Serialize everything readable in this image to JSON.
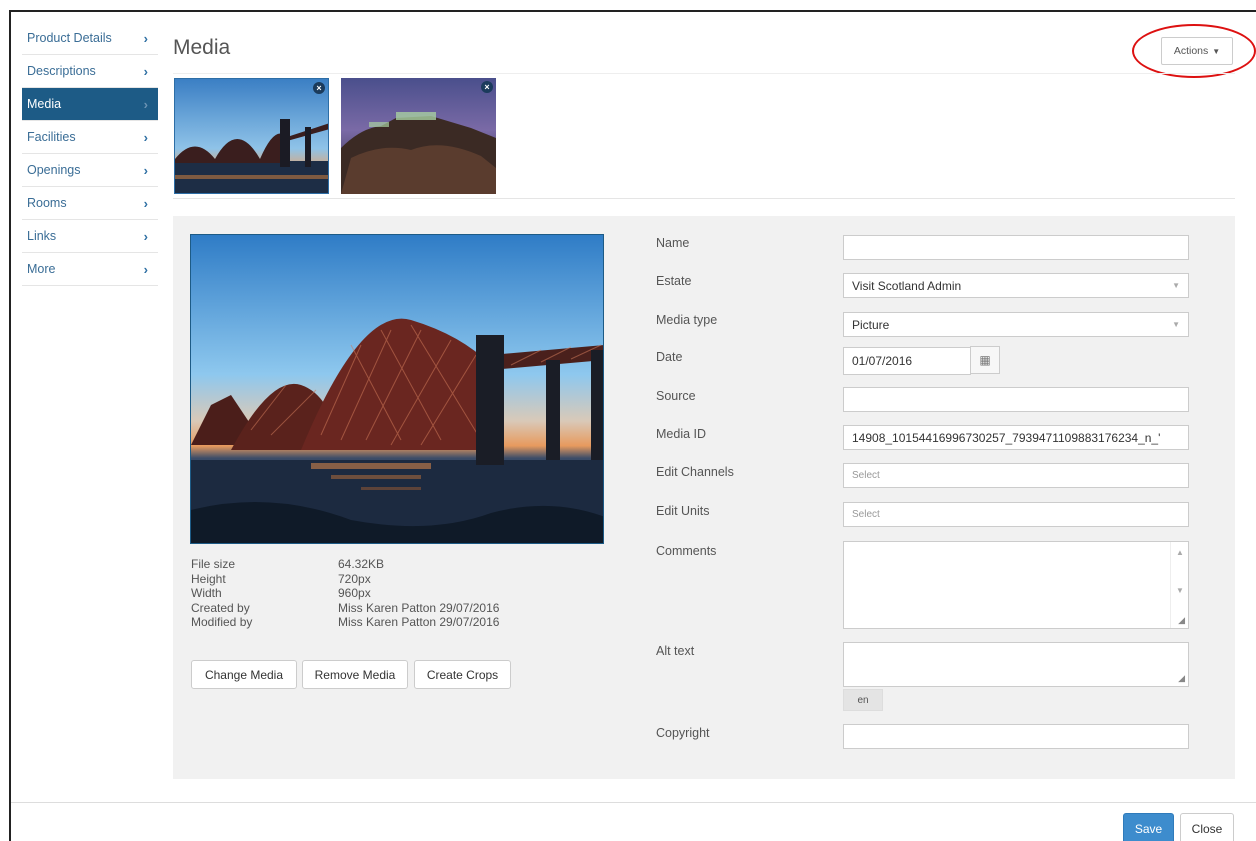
{
  "sidebar": {
    "items": [
      {
        "label": "Product Details",
        "active": false
      },
      {
        "label": "Descriptions",
        "active": false
      },
      {
        "label": "Media",
        "active": true
      },
      {
        "label": "Facilities",
        "active": false
      },
      {
        "label": "Openings",
        "active": false
      },
      {
        "label": "Rooms",
        "active": false
      },
      {
        "label": "Links",
        "active": false
      },
      {
        "label": "More",
        "active": false
      }
    ],
    "chevron": "›"
  },
  "header": {
    "title": "Media",
    "actions_label": "Actions"
  },
  "thumbnails": [
    {
      "name": "forth-bridge-thumbnail",
      "selected": true,
      "remove_icon": "×"
    },
    {
      "name": "castle-rock-thumbnail",
      "selected": false,
      "remove_icon": "×"
    }
  ],
  "file_info": {
    "rows": [
      {
        "label": "File size",
        "value": "64.32KB"
      },
      {
        "label": "Height",
        "value": "720px"
      },
      {
        "label": "Width",
        "value": "960px"
      },
      {
        "label": "Created by",
        "value": "Miss Karen Patton 29/07/2016"
      },
      {
        "label": "Modified by",
        "value": "Miss Karen Patton 29/07/2016"
      }
    ]
  },
  "media_buttons": {
    "change": "Change Media",
    "remove": "Remove Media",
    "crops": "Create Crops"
  },
  "form": {
    "name_label": "Name",
    "name_value": "",
    "estate_label": "Estate",
    "estate_value": "Visit Scotland Admin",
    "media_type_label": "Media type",
    "media_type_value": "Picture",
    "date_label": "Date",
    "date_value": "01/07/2016",
    "source_label": "Source",
    "source_value": "",
    "media_id_label": "Media ID",
    "media_id_value": "14908_10154416996730257_7939471109883176234_n_'",
    "edit_channels_label": "Edit Channels",
    "edit_channels_placeholder": "Select",
    "edit_units_label": "Edit Units",
    "edit_units_placeholder": "Select",
    "comments_label": "Comments",
    "alt_text_label": "Alt text",
    "language": "en",
    "copyright_label": "Copyright",
    "copyright_value": ""
  },
  "footer": {
    "save": "Save",
    "close": "Close"
  },
  "colors": {
    "sidebar_active": "#1d5b86",
    "link": "#3a6d96",
    "primary_button": "#3d8ccd",
    "annotation_circle": "#dd1111"
  }
}
